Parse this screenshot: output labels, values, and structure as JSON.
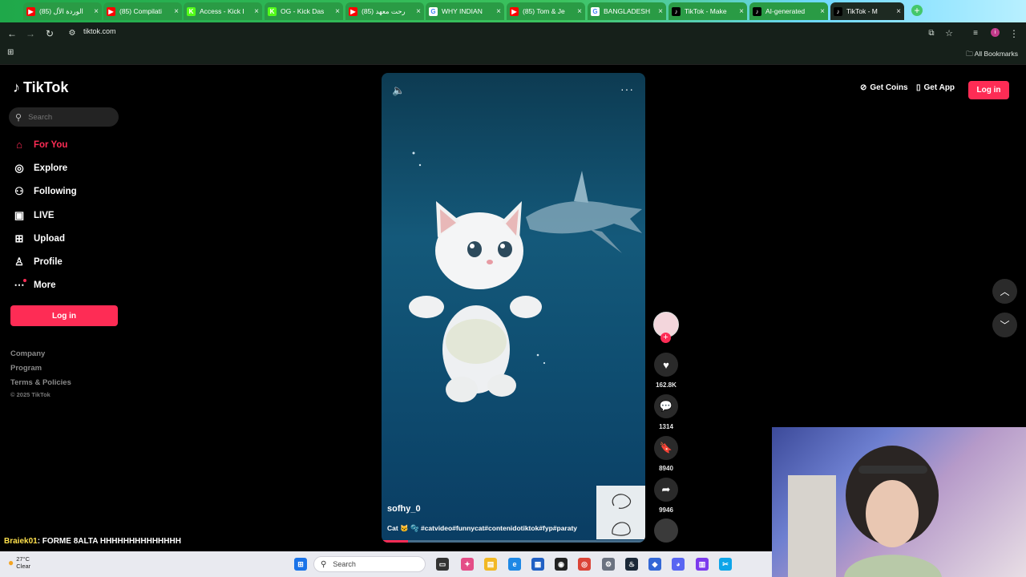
{
  "browser": {
    "tabs": [
      {
        "label": "(85) الوردة الأل",
        "fav": "▶",
        "favcolor": "#ff0000"
      },
      {
        "label": "(85) Compilati",
        "fav": "▶",
        "favcolor": "#ff0000"
      },
      {
        "label": "Access - Kick I",
        "fav": "K",
        "favcolor": "#53fc18"
      },
      {
        "label": "OG - Kick Das",
        "fav": "K",
        "favcolor": "#53fc18"
      },
      {
        "label": "(85) رحت معهد",
        "fav": "▶",
        "favcolor": "#ff0000"
      },
      {
        "label": "WHY INDIAN",
        "fav": "G",
        "favcolor": "#ffffff"
      },
      {
        "label": "(85) Tom & Je",
        "fav": "▶",
        "favcolor": "#ff0000"
      },
      {
        "label": "BANGLADESH",
        "fav": "G",
        "favcolor": "#ffffff"
      },
      {
        "label": "TikTok - Make",
        "fav": "♪",
        "favcolor": "#000000"
      },
      {
        "label": "AI-generated",
        "fav": "♪",
        "favcolor": "#000000"
      },
      {
        "label": "TikTok - M",
        "fav": "♪",
        "favcolor": "#000000"
      }
    ],
    "url": "tiktok.com",
    "all_bookmarks": "All Bookmarks",
    "profile_initial": "i"
  },
  "sidebar": {
    "logo": "TikTok",
    "search_placeholder": "Search",
    "nav": [
      {
        "label": "For You",
        "icon": "home-icon"
      },
      {
        "label": "Explore",
        "icon": "compass-icon"
      },
      {
        "label": "Following",
        "icon": "following-icon"
      },
      {
        "label": "LIVE",
        "icon": "live-icon"
      },
      {
        "label": "Upload",
        "icon": "upload-icon"
      },
      {
        "label": "Profile",
        "icon": "profile-icon"
      },
      {
        "label": "More",
        "icon": "more-icon"
      }
    ],
    "login": "Log in",
    "footer": [
      "Company",
      "Program",
      "Terms & Policies"
    ],
    "copyright": "© 2025 TikTok"
  },
  "header": {
    "get_coins": "Get Coins",
    "get_app": "Get App",
    "login": "Log in"
  },
  "video": {
    "author": "sofhy_0",
    "caption": "Cat 🐱 🫧 #catvideo#funnycat#contenidotiktok#fyp#paraty",
    "progress": 0.1
  },
  "actions": {
    "likes": "162.8K",
    "comments": "1314",
    "saves": "8940",
    "shares": "9946"
  },
  "chat": {
    "user": "Braiek01",
    "message": ": FORME 8ALTA HHHHHHHHHHHHHH"
  },
  "taskbar": {
    "temp": "27°C",
    "weather": "Clear",
    "search": "Search"
  }
}
